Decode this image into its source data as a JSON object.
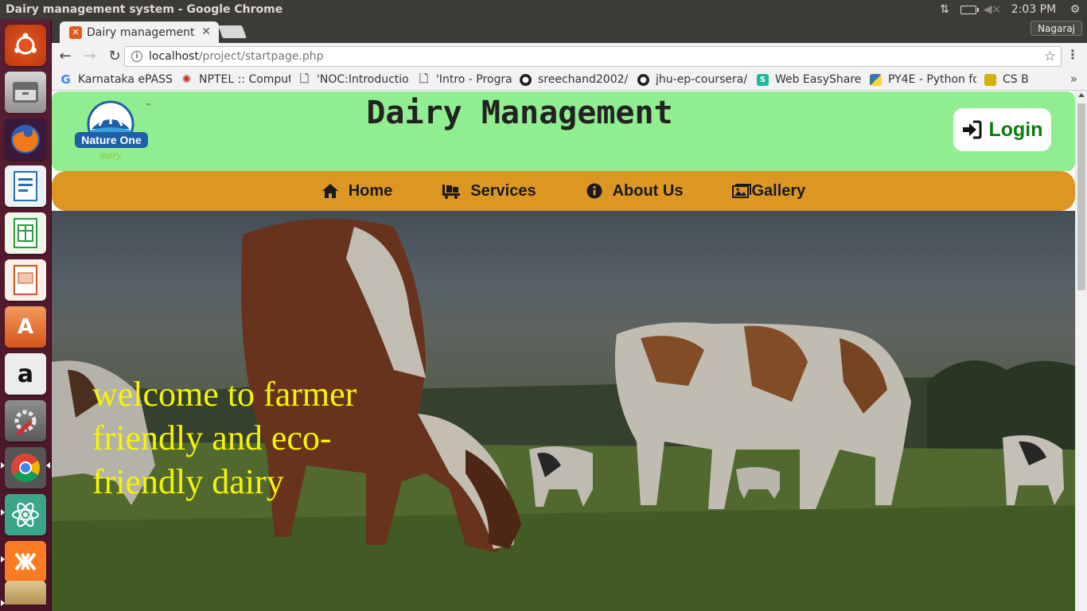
{
  "os": {
    "window_title": "Dairy management system - Google Chrome",
    "clock": "2:03 PM"
  },
  "browser": {
    "tab_title": "Dairy management",
    "user_name": "Nagaraj",
    "url_host": "localhost",
    "url_path": "/project/startpage.php",
    "bookmarks": [
      {
        "label": "Karnataka ePASS",
        "icon": "google-icon",
        "color": "#4285f4"
      },
      {
        "label": "NPTEL :: Comput",
        "icon": "nptel-icon",
        "color": "#c0392b"
      },
      {
        "label": "'NOC:Introductio",
        "icon": "page-icon",
        "color": "#888888"
      },
      {
        "label": "'Intro - Program",
        "icon": "page-icon",
        "color": "#888888"
      },
      {
        "label": "sreechand2002/",
        "icon": "github-icon",
        "color": "#222222"
      },
      {
        "label": "jhu-ep-coursera/",
        "icon": "github-icon",
        "color": "#222222"
      },
      {
        "label": "Web EasyShare",
        "icon": "easyshare-icon",
        "color": "#1abc9c"
      },
      {
        "label": "PY4E - Python fo",
        "icon": "python-icon",
        "color": "#3776ab"
      },
      {
        "label": "CS B",
        "icon": "folder-icon",
        "color": "#d4b106"
      }
    ]
  },
  "site": {
    "logo_text": "Nature One",
    "logo_subtext": "dairy",
    "title": "Dairy Management",
    "login_label": "Login",
    "nav": [
      {
        "label": "Home",
        "icon": "home-icon"
      },
      {
        "label": "Services",
        "icon": "truck-icon"
      },
      {
        "label": "About Us",
        "icon": "info-circle-icon"
      },
      {
        "label": "Gallery",
        "icon": "images-icon"
      }
    ],
    "hero_text": "welcome to farmer friendly and eco-friendly dairy"
  },
  "colors": {
    "header_bg": "#90ee90",
    "nav_bg": "#dc9623",
    "login_text": "#0b7d0b",
    "hero_text": "#f5f500",
    "launcher_bg": "#5a1f32"
  }
}
